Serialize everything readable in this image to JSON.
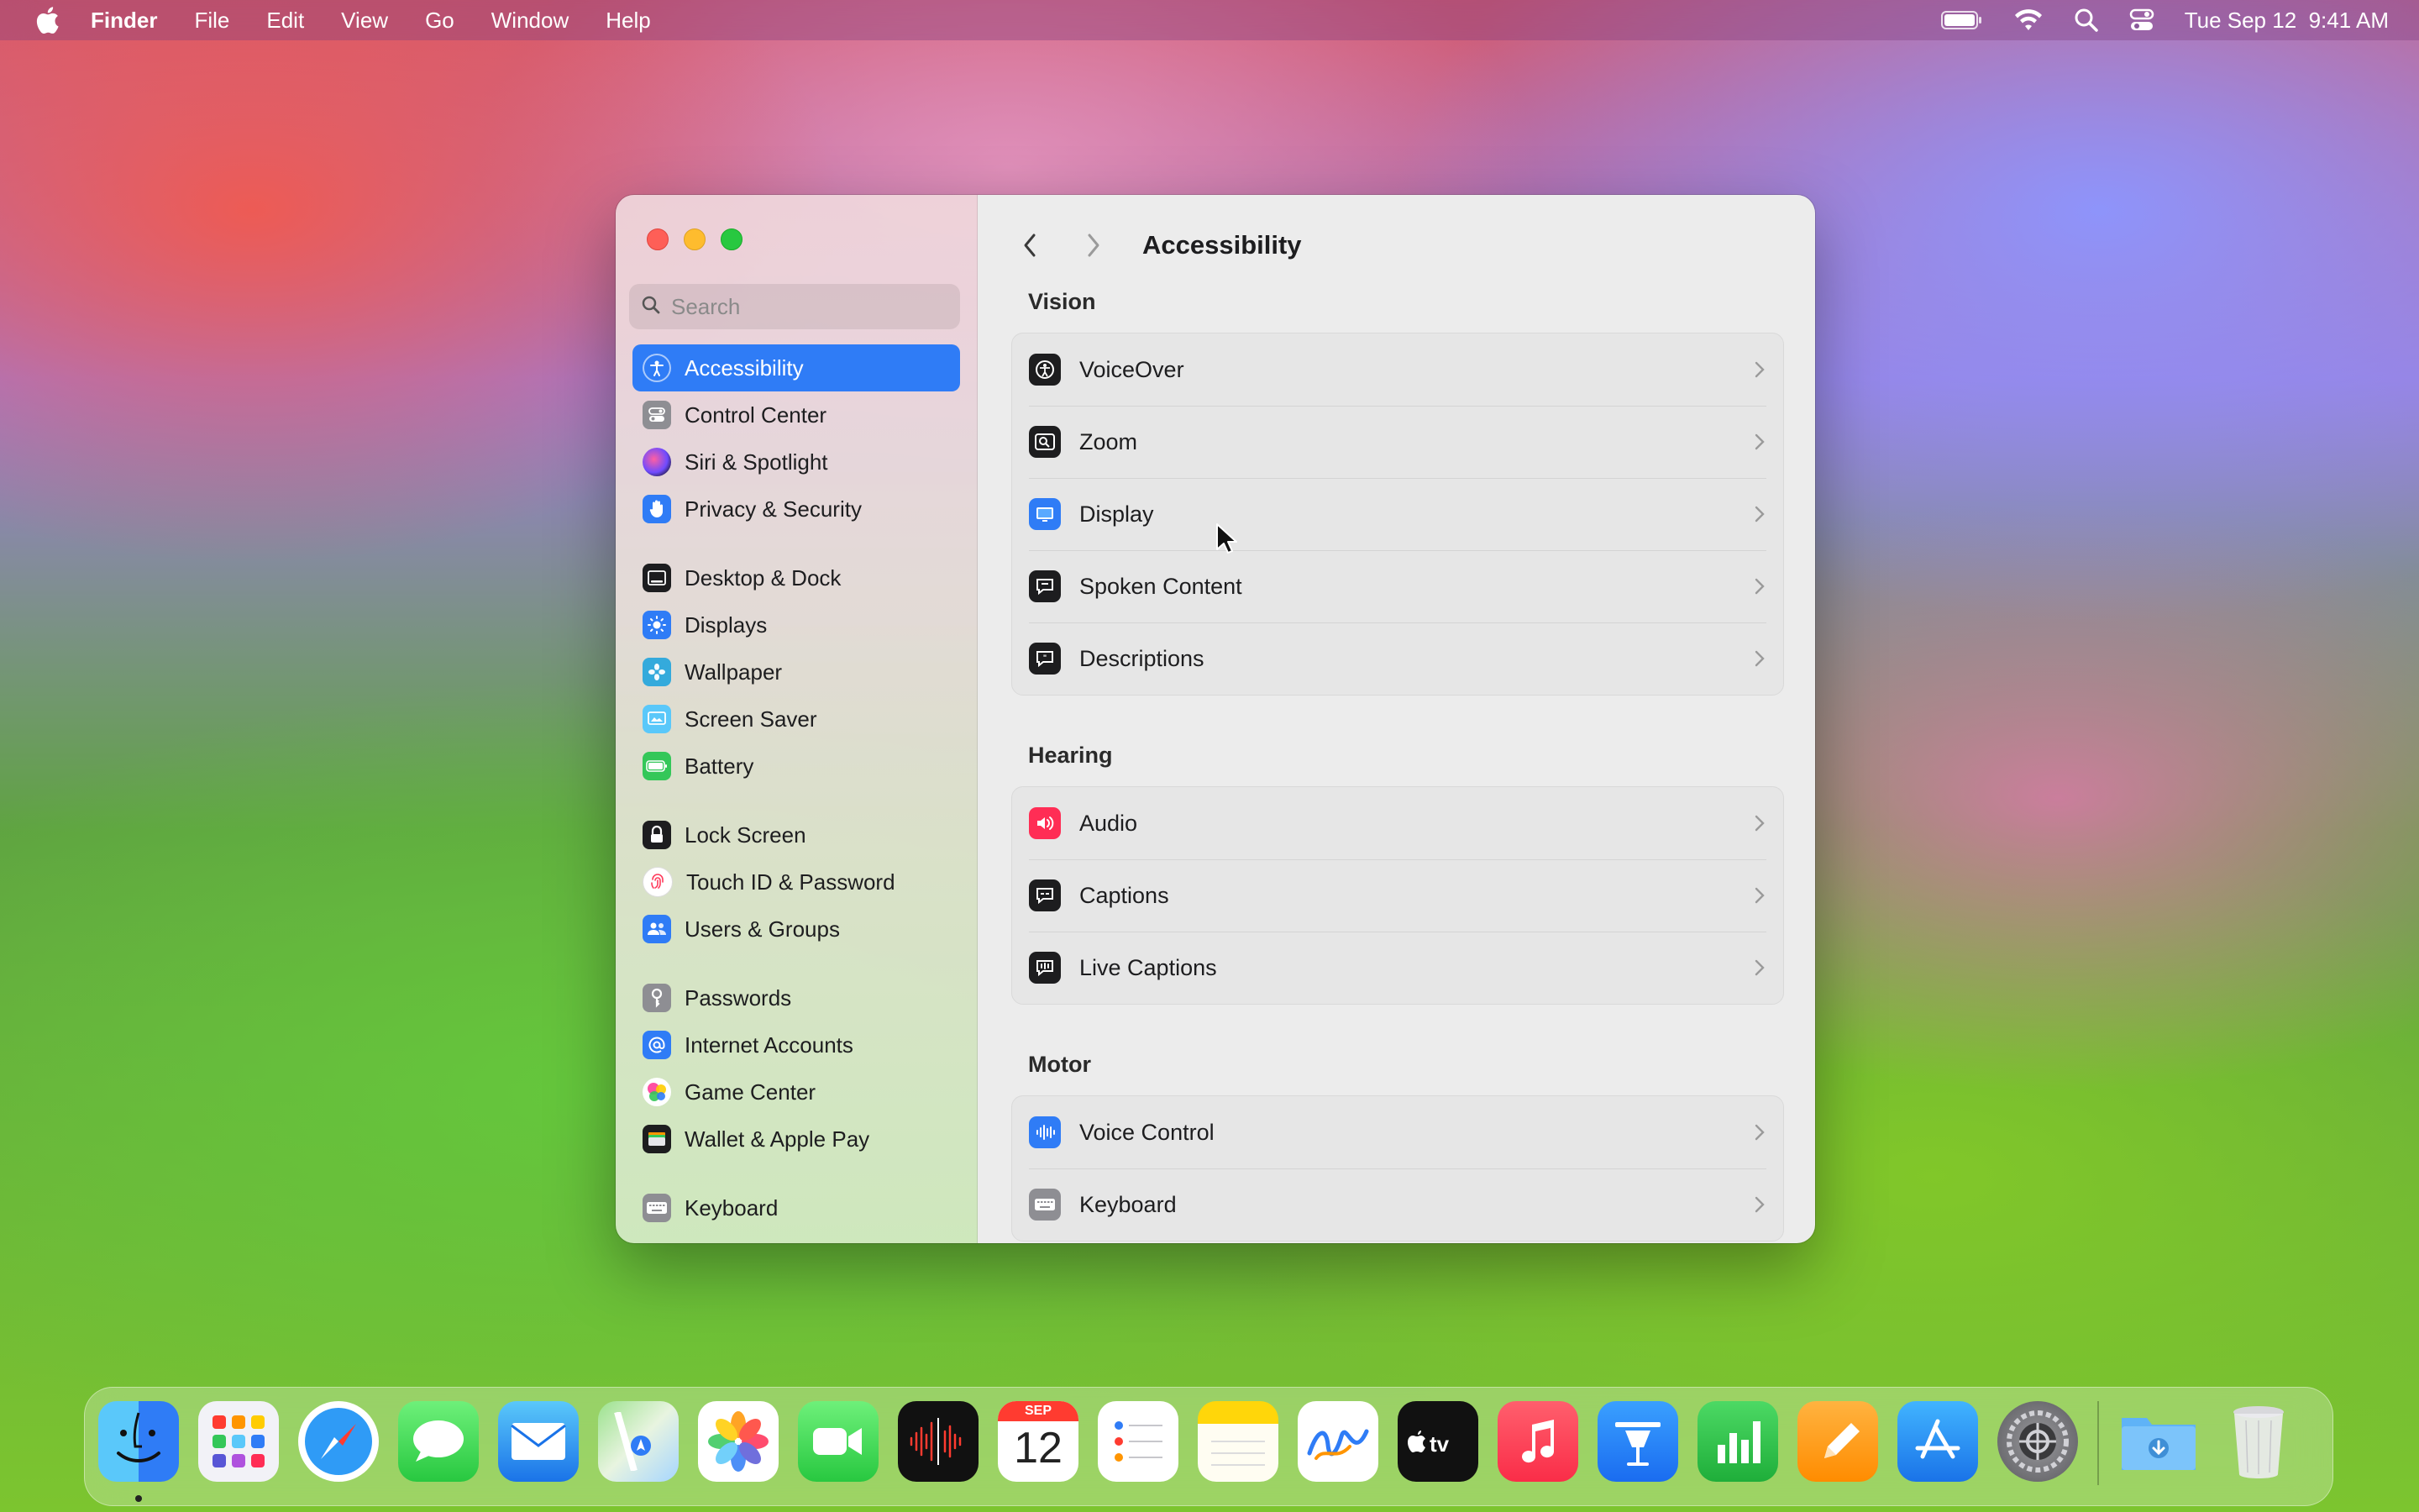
{
  "menubar": {
    "app_name": "Finder",
    "items": [
      "File",
      "Edit",
      "View",
      "Go",
      "Window",
      "Help"
    ],
    "clock": "Tue Sep 12  9:41 AM",
    "status_icons": [
      "battery-icon",
      "wifi-icon",
      "spotlight-search-icon",
      "control-center-icon"
    ]
  },
  "sidebar": {
    "search_placeholder": "Search",
    "items": [
      {
        "label": "Accessibility",
        "icon": "accessibility-icon",
        "color": "#2f7cf6",
        "active": true
      },
      {
        "label": "Control Center",
        "icon": "control-center-icon",
        "color": "#8e8e93"
      },
      {
        "label": "Siri & Spotlight",
        "icon": "siri-icon",
        "color": "#5e5ce6"
      },
      {
        "label": "Privacy & Security",
        "icon": "hand-icon",
        "color": "#2f7cf6"
      },
      {
        "label": "Desktop & Dock",
        "icon": "desktop-dock-icon",
        "color": "#1d1d1f"
      },
      {
        "label": "Displays",
        "icon": "displays-icon",
        "color": "#2f7cf6"
      },
      {
        "label": "Wallpaper",
        "icon": "wallpaper-icon",
        "color": "#34aadc"
      },
      {
        "label": "Screen Saver",
        "icon": "screen-saver-icon",
        "color": "#5ac8fa"
      },
      {
        "label": "Battery",
        "icon": "battery-icon",
        "color": "#34c759"
      },
      {
        "label": "Lock Screen",
        "icon": "lock-icon",
        "color": "#1d1d1f"
      },
      {
        "label": "Touch ID & Password",
        "icon": "fingerprint-icon",
        "color": "#ff3b5c"
      },
      {
        "label": "Users & Groups",
        "icon": "users-icon",
        "color": "#2f7cf6"
      },
      {
        "label": "Passwords",
        "icon": "key-icon",
        "color": "#8e8e93"
      },
      {
        "label": "Internet Accounts",
        "icon": "at-icon",
        "color": "#2f7cf6"
      },
      {
        "label": "Game Center",
        "icon": "game-center-icon",
        "color": "#ff9500"
      },
      {
        "label": "Wallet & Apple Pay",
        "icon": "wallet-icon",
        "color": "#1d1d1f"
      },
      {
        "label": "Keyboard",
        "icon": "keyboard-icon",
        "color": "#8e8e93"
      }
    ]
  },
  "main": {
    "title": "Accessibility",
    "sections": [
      {
        "title": "Vision",
        "rows": [
          {
            "label": "VoiceOver",
            "icon": "voiceover-icon",
            "color": "#1d1d1f"
          },
          {
            "label": "Zoom",
            "icon": "zoom-icon",
            "color": "#1d1d1f"
          },
          {
            "label": "Display",
            "icon": "display-icon",
            "color": "#2f7cf6"
          },
          {
            "label": "Spoken Content",
            "icon": "spoken-content-icon",
            "color": "#1d1d1f"
          },
          {
            "label": "Descriptions",
            "icon": "descriptions-icon",
            "color": "#1d1d1f"
          }
        ]
      },
      {
        "title": "Hearing",
        "rows": [
          {
            "label": "Audio",
            "icon": "audio-icon",
            "color": "#ff2d55"
          },
          {
            "label": "Captions",
            "icon": "captions-icon",
            "color": "#1d1d1f"
          },
          {
            "label": "Live Captions",
            "icon": "live-captions-icon",
            "color": "#1d1d1f"
          }
        ]
      },
      {
        "title": "Motor",
        "rows": [
          {
            "label": "Voice Control",
            "icon": "voice-control-icon",
            "color": "#2f7cf6"
          },
          {
            "label": "Keyboard",
            "icon": "keyboard-icon",
            "color": "#8e8e93"
          }
        ]
      }
    ]
  },
  "calendar_icon": {
    "month": "SEP",
    "day": "12"
  },
  "dock": {
    "apps": [
      {
        "name": "Finder",
        "icon": "finder-icon",
        "running": true
      },
      {
        "name": "Launchpad",
        "icon": "launchpad-icon"
      },
      {
        "name": "Safari",
        "icon": "safari-icon"
      },
      {
        "name": "Messages",
        "icon": "messages-icon"
      },
      {
        "name": "Mail",
        "icon": "mail-icon"
      },
      {
        "name": "Maps",
        "icon": "maps-icon"
      },
      {
        "name": "Photos",
        "icon": "photos-icon"
      },
      {
        "name": "FaceTime",
        "icon": "facetime-icon"
      },
      {
        "name": "Voice Memos",
        "icon": "voice-memos-icon"
      },
      {
        "name": "Calendar",
        "icon": "calendar-icon"
      },
      {
        "name": "Reminders",
        "icon": "reminders-icon"
      },
      {
        "name": "Notes",
        "icon": "notes-icon"
      },
      {
        "name": "Freeform",
        "icon": "freeform-icon"
      },
      {
        "name": "Apple TV",
        "icon": "apple-tv-icon"
      },
      {
        "name": "Music",
        "icon": "music-icon"
      },
      {
        "name": "Keynote",
        "icon": "keynote-icon"
      },
      {
        "name": "Numbers",
        "icon": "numbers-icon"
      },
      {
        "name": "Pages",
        "icon": "pages-icon"
      },
      {
        "name": "App Store",
        "icon": "app-store-icon"
      },
      {
        "name": "System Settings",
        "icon": "system-settings-icon",
        "running": true
      },
      {
        "name": "Downloads",
        "icon": "downloads-folder-icon"
      },
      {
        "name": "Trash",
        "icon": "trash-icon"
      }
    ]
  }
}
